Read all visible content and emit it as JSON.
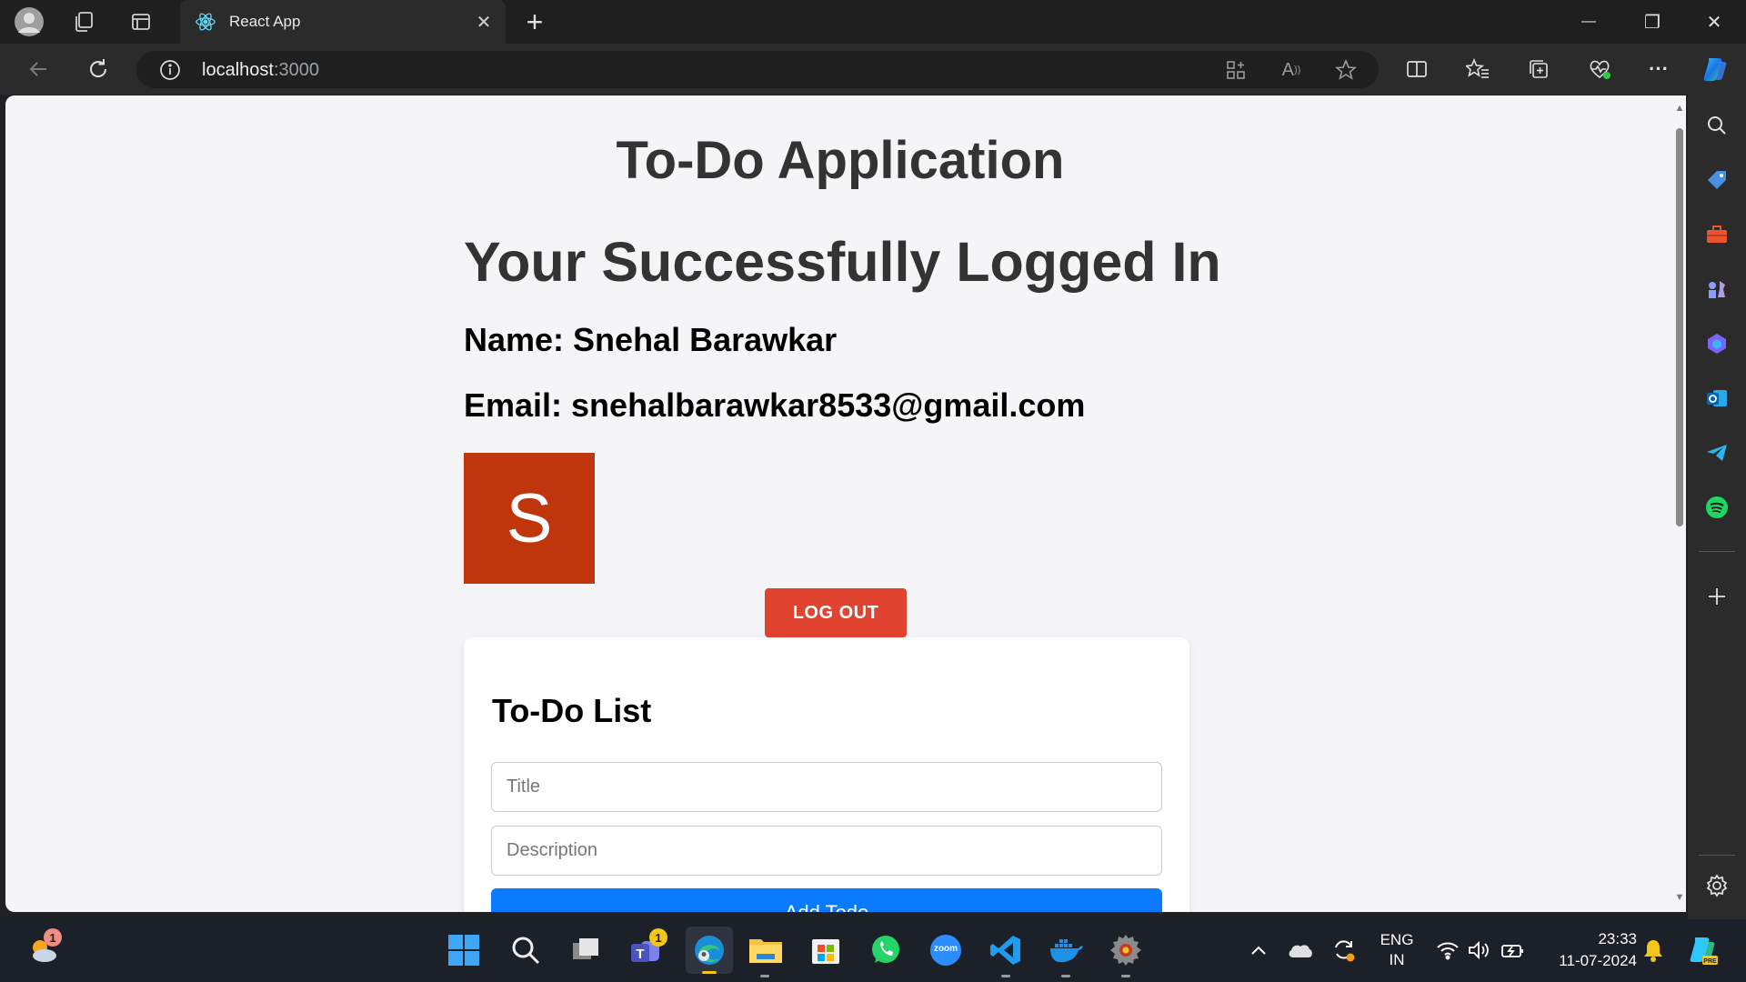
{
  "browser": {
    "tab_title": "React App",
    "url_host": "localhost",
    "url_port": ":3000",
    "close_tab_symbol": "✕",
    "new_tab_symbol": "+",
    "minimize_symbol": "—",
    "restore_symbol": "❐",
    "close_window_symbol": "✕",
    "more_symbol": "···"
  },
  "page": {
    "title": "To-Do Application",
    "login_heading": "Your Successfully Logged In",
    "name_line": "Name: Snehal Barawkar",
    "email_line": "Email: snehalbarawkar8533@gmail.com",
    "avatar_letter": "S",
    "avatar_color": "#bf360c",
    "logout_label": "LOG OUT"
  },
  "todo": {
    "heading": "To-Do List",
    "title_placeholder": "Title",
    "description_placeholder": "Description",
    "add_button_label": "Add Todo"
  },
  "taskbar": {
    "weather_badge": "1",
    "teams_badge": "1",
    "language_line1": "ENG",
    "language_line2": "IN",
    "time": "23:33",
    "date": "11-07-2024",
    "zoom_label": "zoom"
  },
  "colors": {
    "accent_blue": "#0a7bff",
    "logout_red": "#e0432f"
  }
}
